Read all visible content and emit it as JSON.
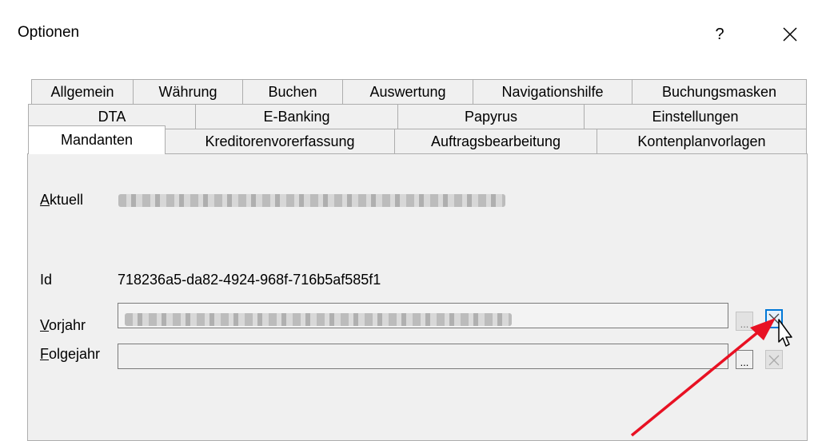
{
  "window": {
    "title": "Optionen",
    "help_label": "?"
  },
  "tabs": {
    "row1": [
      "Allgemein",
      "Währung",
      "Buchen",
      "Auswertung",
      "Navigationshilfe",
      "Buchungsmasken"
    ],
    "row2": [
      "DTA",
      "E-Banking",
      "Papyrus",
      "Einstellungen"
    ],
    "row3": [
      "Mandanten",
      "Kreditorenvorerfassung",
      "Auftragsbearbeitung",
      "Kontenplanvorlagen"
    ],
    "active": "Mandanten"
  },
  "fields": {
    "aktuell": {
      "label": "Aktuell",
      "accesskey": "A",
      "rest": "ktuell"
    },
    "id": {
      "label": "Id",
      "value": "718236a5-da82-4924-968f-716b5af585f1"
    },
    "vorjahr": {
      "label": "Vorjahr",
      "accesskey": "V",
      "rest": "orjahr",
      "browse_label": "...",
      "clear_icon": "close-icon"
    },
    "folgejahr": {
      "label": "Folgejahr",
      "accesskey": "F",
      "rest": "olgejahr",
      "value": "",
      "browse_label": "...",
      "clear_icon": "close-icon"
    }
  },
  "colors": {
    "panel": "#f0f0f0",
    "hover_accent": "#0078d7",
    "arrow": "#e81123"
  }
}
